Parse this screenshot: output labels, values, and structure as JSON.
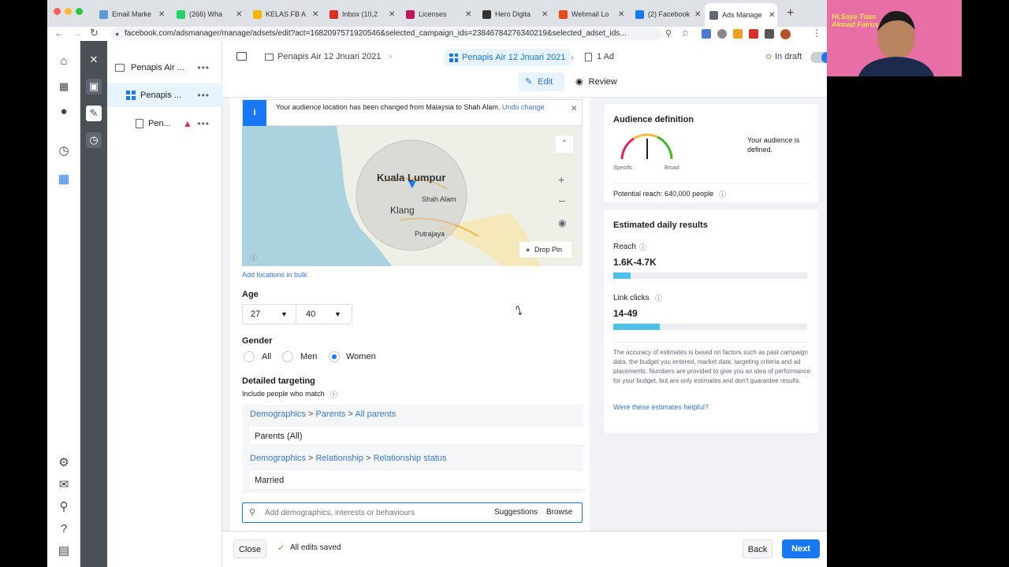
{
  "browser": {
    "tabs": [
      {
        "label": "Email Marke",
        "favicon_color": "#5b9bd5"
      },
      {
        "label": "(266) Wha",
        "favicon_color": "#25d366"
      },
      {
        "label": "KELAS FB A",
        "favicon_color": "#f7b500"
      },
      {
        "label": "Inbox (10,2",
        "favicon_color": "#d93025"
      },
      {
        "label": "Licenses",
        "favicon_color": "#c2185b"
      },
      {
        "label": "Hero Digita",
        "favicon_color": "#333333"
      },
      {
        "label": "Webmail Lo",
        "favicon_color": "#e64a19"
      },
      {
        "label": "(2) Facebook",
        "favicon_color": "#1877f2"
      },
      {
        "label": "Ads Manage",
        "favicon_color": "#606770"
      }
    ],
    "new_tab_icon": "+",
    "url": "facebook.com/adsmanager/manage/adsets/edit?act=1682097571920546&selected_campaign_ids=23846784276340219&selected_adset_ids..."
  },
  "tree": {
    "items": [
      {
        "label": "Penapis Air ...",
        "icon": "folder-icon"
      },
      {
        "label": "Penapis ...",
        "icon": "grid-icon"
      },
      {
        "label": "Pen...",
        "icon": "page-icon"
      }
    ]
  },
  "topbar": {
    "crumb_campaign": "Penapis Air 12 Jnuari 2021",
    "crumb_adset": "Penapis Air 12 Jnuari 2021",
    "crumb_ad": "1 Ad",
    "status": "In draft",
    "edit_label": "Edit",
    "review_label": "Review"
  },
  "location": {
    "notice_text": "Your audience location has been changed from Malaysia to Shah Alam.",
    "undo_label": "Undo change",
    "map_labels": {
      "city1": "Kuala Lumpur",
      "city2": "Shah Alam",
      "city3": "Klang",
      "city4": "Putrajaya"
    },
    "drop_pin_label": "Drop Pin",
    "add_bulk_label": "Add locations in bulk"
  },
  "age": {
    "label": "Age",
    "min": "27",
    "max": "40"
  },
  "gender": {
    "label": "Gender",
    "options": [
      "All",
      "Men",
      "Women"
    ],
    "selected": "Women"
  },
  "targeting": {
    "label": "Detailed targeting",
    "sublabel": "Include people who match",
    "groups": [
      {
        "path": [
          "Demographics",
          "Parents",
          "All parents"
        ],
        "item": "Parents (All)"
      },
      {
        "path": [
          "Demographics",
          "Relationship",
          "Relationship status"
        ],
        "item": "Married"
      }
    ],
    "search_placeholder": "Add demographics, interests or behaviours",
    "suggestions_label": "Suggestions",
    "browse_label": "Browse"
  },
  "audience": {
    "title": "Audience definition",
    "status": "Your audience is defined.",
    "gauge_left": "Specific",
    "gauge_right": "Broad",
    "reach": "Potential reach: 640,000 people"
  },
  "estimates": {
    "title": "Estimated daily results",
    "reach_label": "Reach",
    "reach_value": "1.6K-4.7K",
    "reach_fill": 0.09,
    "clicks_label": "Link clicks",
    "clicks_value": "14-49",
    "clicks_fill": 0.24,
    "disclaimer": "The accuracy of estimates is based on factors such as past campaign data, the budget you entered, market data, targeting criteria and ad placements. Numbers are provided to give you an idea of performance for your budget, but are only estimates and don't guarantee results.",
    "helpful_link": "Were these estimates helpful?"
  },
  "footer": {
    "close": "Close",
    "saved": "All edits saved",
    "back": "Back",
    "next": "Next"
  },
  "webcam": {
    "overlay_text": "Hi,Saya Tuan Akmad Fairus"
  },
  "colors": {
    "accent": "#1877f2",
    "link": "#3578e5",
    "bar": "#4fc1e9"
  }
}
